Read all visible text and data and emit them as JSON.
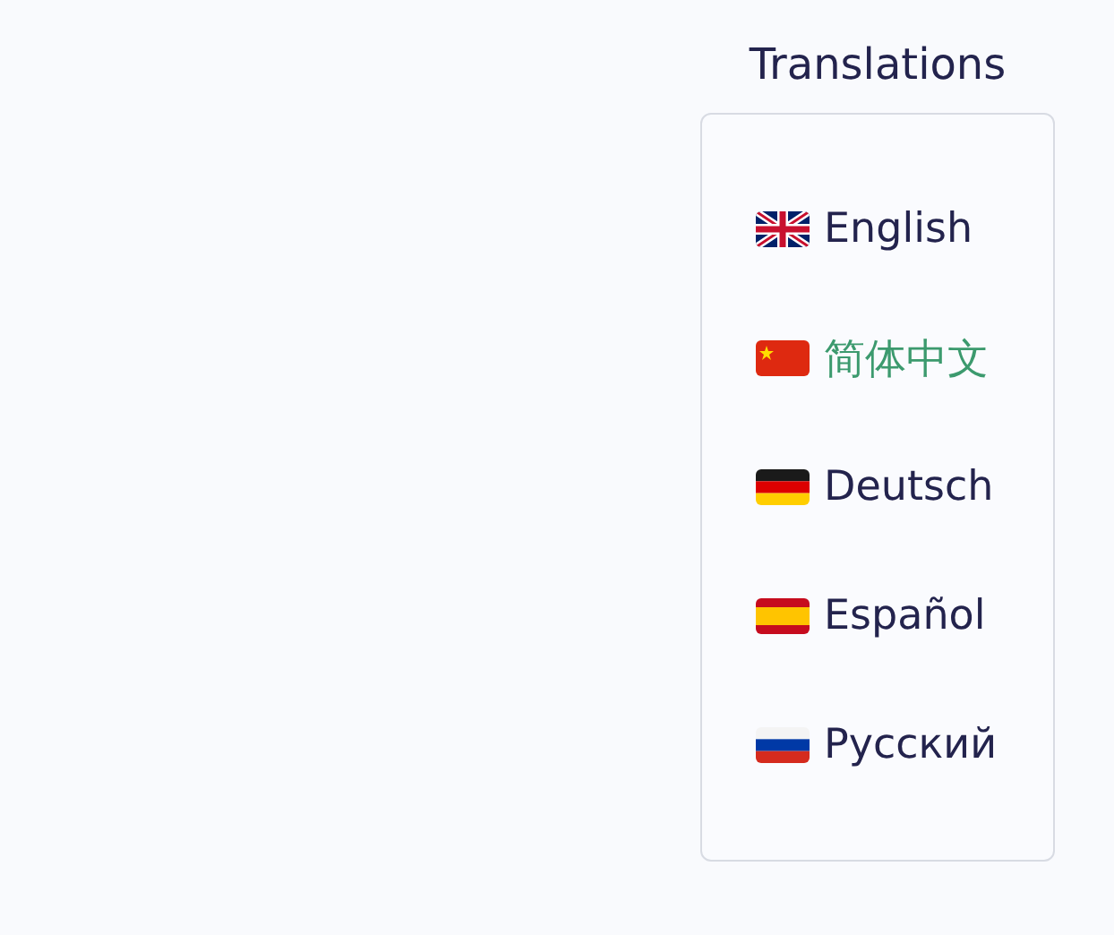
{
  "title": "Translations",
  "languages": [
    {
      "label": "English",
      "selected": false
    },
    {
      "label": "简体中文",
      "selected": true
    },
    {
      "label": "Deutsch",
      "selected": false
    },
    {
      "label": "Español",
      "selected": false
    },
    {
      "label": "Русский",
      "selected": false
    }
  ]
}
